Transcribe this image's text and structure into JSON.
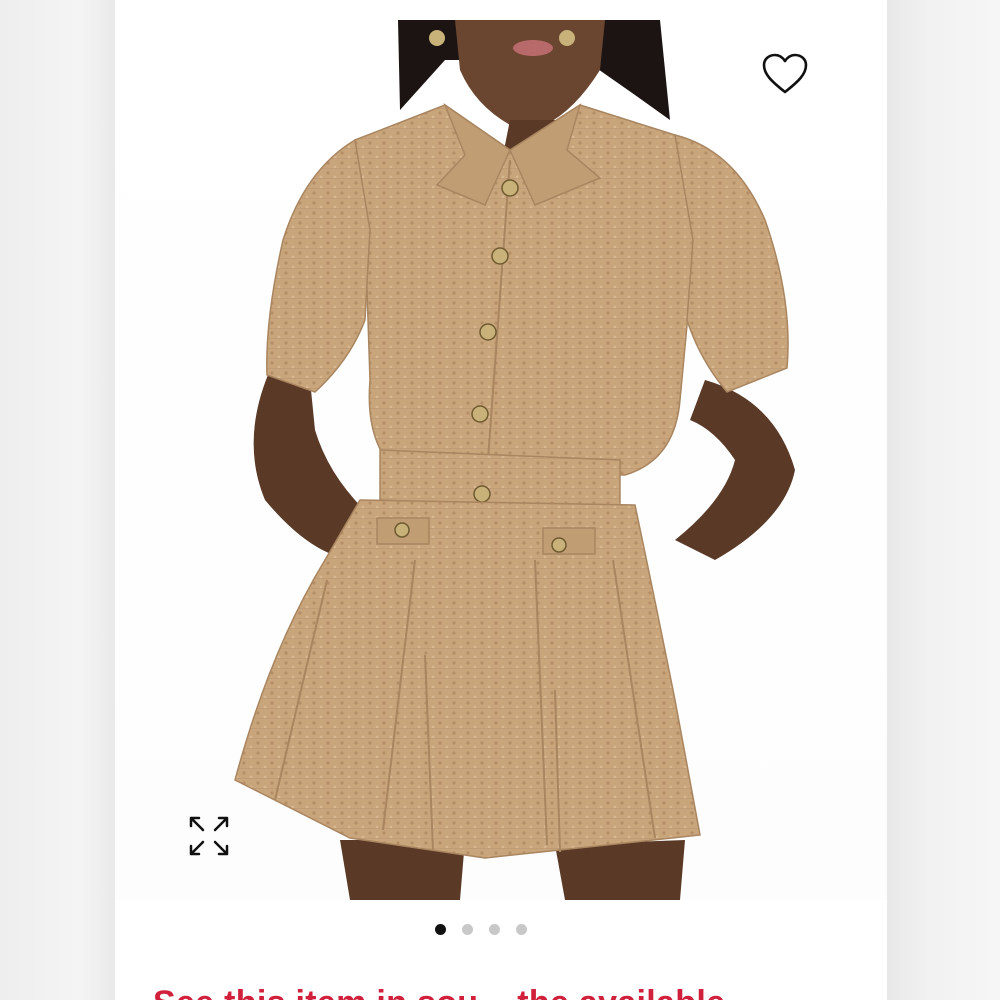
{
  "product": {
    "image_alt": "Tan tweed cropped button-front shirt and pleated mini skirt set",
    "fabric_color": "#c9a57c",
    "fabric_shadow": "#a98560",
    "skin_color": "#5a3a26",
    "button_color": "#c8b27a"
  },
  "actions": {
    "favorite_icon": "heart-outline-icon",
    "expand_icon": "expand-arrows-icon"
  },
  "carousel": {
    "total": 4,
    "active_index": 0
  },
  "notice": {
    "text": "See this item in sou... the available..."
  },
  "colors": {
    "notice": "#d0203b",
    "dot_active": "#111111",
    "dot_inactive": "#c8c8c8"
  }
}
